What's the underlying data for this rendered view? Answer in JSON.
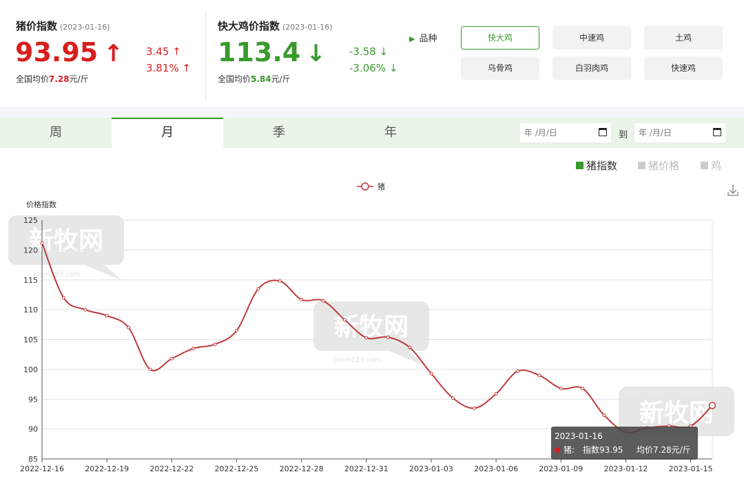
{
  "pig": {
    "title": "猪价指数",
    "date": "(2023-01-16)",
    "value": "93.95",
    "arrow": "↑",
    "delta_abs": "3.45 ↑",
    "delta_pct": "3.81% ↑",
    "avg_prefix": "全国均价",
    "avg_value": "7.28",
    "avg_unit": "元/斤"
  },
  "chicken": {
    "title": "快大鸡价指数",
    "date": "(2023-01-16)",
    "value": "113.4",
    "arrow": "↓",
    "delta_abs": "-3.58 ↓",
    "delta_pct": "-3.06% ↓",
    "avg_prefix": "全国均价",
    "avg_value": "5.84",
    "avg_unit": "元/斤"
  },
  "variety": {
    "label": "品种",
    "icon": "triangle-right-icon",
    "options": [
      "快大鸡",
      "中速鸡",
      "土鸡",
      "乌骨鸡",
      "白羽肉鸡",
      "快速鸡"
    ],
    "selected": "快大鸡"
  },
  "tabs": [
    "周",
    "月",
    "季",
    "年"
  ],
  "active_tab": "月",
  "date_range": {
    "start_placeholder": "年 /月/日",
    "to_label": "到",
    "end_placeholder": "年 /月/日"
  },
  "type_legend": [
    {
      "label": "猪指数",
      "color": "#3a9a2e",
      "active": true
    },
    {
      "label": "猪价格",
      "color": "#cccccc",
      "active": false
    },
    {
      "label": "鸡",
      "color": "#cccccc",
      "active": false
    }
  ],
  "colors": {
    "accent": "#3a9a2e",
    "up": "#d81e1e",
    "line": "#c0393b"
  },
  "watermark": "新牧网",
  "watermark_url": "xinm123.com",
  "tooltip": {
    "date": "2023-01-16",
    "series": "猪:",
    "index_text": "指数93.95",
    "price_text": "均价7.28元/斤"
  },
  "chart_data": {
    "type": "line",
    "ylabel": "价格指数",
    "ylim": [
      85,
      125
    ],
    "yticks": [
      85,
      90,
      95,
      100,
      105,
      110,
      115,
      120,
      125
    ],
    "grid": true,
    "legend_position": "top-center",
    "xtick_labels": [
      "2022-12-16",
      "2022-12-19",
      "2022-12-22",
      "2022-12-25",
      "2022-12-28",
      "2022-12-31",
      "2023-01-03",
      "2023-01-06",
      "2023-01-09",
      "2023-01-12",
      "2023-01-15"
    ],
    "series": [
      {
        "name": "猪",
        "x": [
          "2022-12-16",
          "2022-12-17",
          "2022-12-18",
          "2022-12-19",
          "2022-12-20",
          "2022-12-21",
          "2022-12-22",
          "2022-12-23",
          "2022-12-24",
          "2022-12-25",
          "2022-12-26",
          "2022-12-27",
          "2022-12-28",
          "2022-12-29",
          "2022-12-30",
          "2022-12-31",
          "2023-01-01",
          "2023-01-02",
          "2023-01-03",
          "2023-01-04",
          "2023-01-05",
          "2023-01-06",
          "2023-01-07",
          "2023-01-08",
          "2023-01-09",
          "2023-01-10",
          "2023-01-11",
          "2023-01-12",
          "2023-01-13",
          "2023-01-14",
          "2023-01-15",
          "2023-01-16"
        ],
        "values": [
          121.2,
          112.0,
          110.0,
          109.0,
          107.0,
          100.0,
          101.8,
          103.5,
          104.2,
          106.5,
          113.5,
          114.8,
          111.7,
          111.5,
          108.3,
          105.3,
          105.4,
          103.7,
          99.3,
          95.2,
          93.5,
          95.9,
          99.7,
          99.0,
          96.8,
          96.8,
          92.3,
          89.5,
          90.2,
          90.5,
          90.5,
          93.95
        ]
      }
    ]
  }
}
